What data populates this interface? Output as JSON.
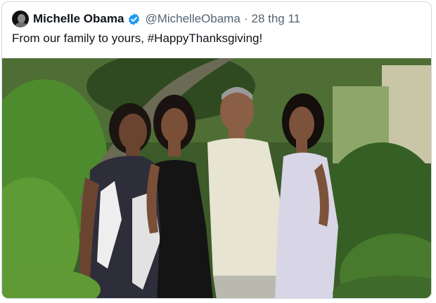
{
  "tweet": {
    "display_name": "Michelle Obama",
    "handle": "@MichelleObama",
    "separator": "·",
    "date": "28 thg 11",
    "text_prefix": "From our family to yours, ",
    "hashtag": "#HappyThanksgiving",
    "text_suffix": "!"
  },
  "icons": {
    "avatar": "avatar-photo",
    "verified": "verified-badge-icon"
  },
  "colors": {
    "verified_blue": "#1d9bf0",
    "name_text": "#0f1419",
    "secondary_text": "#536471",
    "border": "#cfd9de"
  }
}
